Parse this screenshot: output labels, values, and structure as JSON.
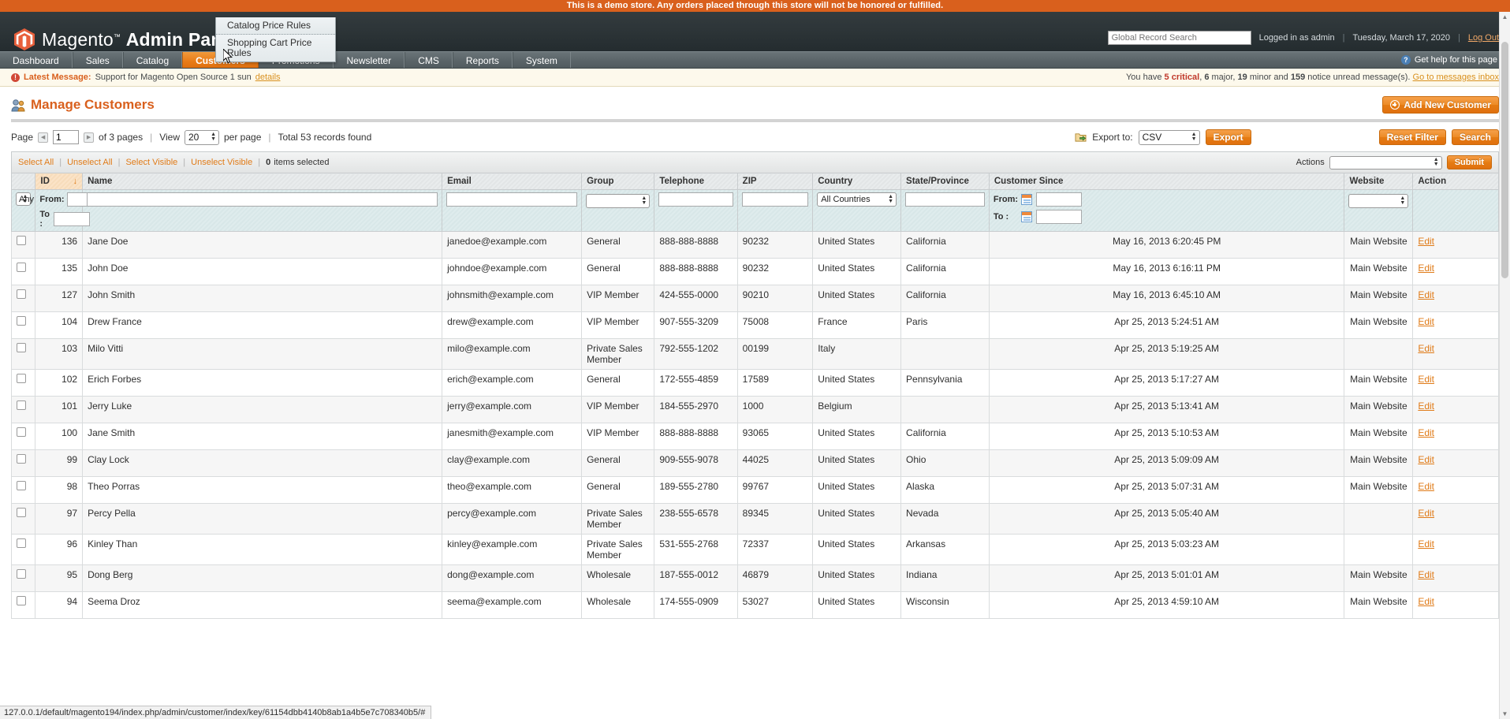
{
  "demo_banner": "This is a demo store. Any orders placed through this store will not be honored or fulfilled.",
  "header": {
    "logo_text_light": "Magento",
    "logo_tm": "™",
    "logo_text_bold": "Admin Panel",
    "search_placeholder": "Global Record Search",
    "search_value": "",
    "logged_in": "Logged in as admin",
    "date": "Tuesday, March 17, 2020",
    "logout": "Log Out",
    "sep": "|"
  },
  "nav": {
    "items": [
      {
        "label": "Dashboard",
        "active": false
      },
      {
        "label": "Sales",
        "active": false
      },
      {
        "label": "Catalog",
        "active": false
      },
      {
        "label": "Customers",
        "active": true
      },
      {
        "label": "Promotions",
        "active": false
      },
      {
        "label": "Newsletter",
        "active": false
      },
      {
        "label": "CMS",
        "active": false
      },
      {
        "label": "Reports",
        "active": false
      },
      {
        "label": "System",
        "active": false
      }
    ],
    "help_icon": "question-mark-icon",
    "help_label": "Get help for this page",
    "dropdown": {
      "parent": "Promotions",
      "items": [
        "Catalog Price Rules",
        "Shopping Cart Price Rules"
      ]
    }
  },
  "message_bar": {
    "icon": "alert-icon",
    "label": "Latest Message:",
    "body": "Support for Magento Open Source 1 sun",
    "details_link": "details",
    "right_prefix": "You have",
    "critical_count": "5",
    "critical_word": "critical",
    "major_count": "6",
    "major_word": "major,",
    "minor_count": "19",
    "minor_word": "minor and",
    "notice_count": "159",
    "notice_word": "notice unread message(s).",
    "inbox_link": "Go to messages inbox"
  },
  "page": {
    "title": "Manage Customers",
    "title_icon": "customers-icon",
    "add_button": "Add New Customer"
  },
  "toolbar": {
    "page_label": "Page",
    "page_value": "1",
    "of_pages": "of 3 pages",
    "view_label": "View",
    "per_page_value": "20",
    "per_page_label": "per page",
    "total_records": "Total 53 records found",
    "export_icon": "export-icon",
    "export_label": "Export to:",
    "export_format": "CSV",
    "export_button": "Export",
    "reset_filter_button": "Reset Filter",
    "search_button": "Search",
    "separator": "|"
  },
  "massaction": {
    "select_all": "Select All",
    "unselect_all": "Unselect All",
    "select_visible": "Select Visible",
    "unselect_visible": "Unselect Visible",
    "items_selected_count": "0",
    "items_selected_label": "items selected",
    "actions_label": "Actions",
    "actions_value": "",
    "submit_button": "Submit",
    "separator": "|"
  },
  "grid": {
    "columns": [
      {
        "key": "checkbox",
        "label": ""
      },
      {
        "key": "id",
        "label": "ID",
        "sorted": true,
        "sort_dir": "desc"
      },
      {
        "key": "name",
        "label": "Name"
      },
      {
        "key": "email",
        "label": "Email"
      },
      {
        "key": "group",
        "label": "Group"
      },
      {
        "key": "telephone",
        "label": "Telephone"
      },
      {
        "key": "zip",
        "label": "ZIP"
      },
      {
        "key": "country",
        "label": "Country"
      },
      {
        "key": "state",
        "label": "State/Province"
      },
      {
        "key": "since",
        "label": "Customer Since"
      },
      {
        "key": "website",
        "label": "Website"
      },
      {
        "key": "action",
        "label": "Action"
      }
    ],
    "filters": {
      "any_select": "Any",
      "id_from_label": "From:",
      "id_to_label": "To :",
      "id_from": "",
      "id_to": "",
      "name": "",
      "email": "",
      "group": "",
      "telephone": "",
      "zip": "",
      "country": "All Countries",
      "state": "",
      "since_from_label": "From:",
      "since_to_label": "To :",
      "since_from": "",
      "since_to": "",
      "website": ""
    },
    "edit_label": "Edit",
    "rows": [
      {
        "id": "136",
        "name": "Jane Doe",
        "email": "janedoe@example.com",
        "group": "General",
        "telephone": "888-888-8888",
        "zip": "90232",
        "country": "United States",
        "state": "California",
        "since": "May 16, 2013 6:20:45 PM",
        "website": "Main Website"
      },
      {
        "id": "135",
        "name": "John Doe",
        "email": "johndoe@example.com",
        "group": "General",
        "telephone": "888-888-8888",
        "zip": "90232",
        "country": "United States",
        "state": "California",
        "since": "May 16, 2013 6:16:11 PM",
        "website": "Main Website"
      },
      {
        "id": "127",
        "name": "John Smith",
        "email": "johnsmith@example.com",
        "group": "VIP Member",
        "telephone": "424-555-0000",
        "zip": "90210",
        "country": "United States",
        "state": "California",
        "since": "May 16, 2013 6:45:10 AM",
        "website": "Main Website"
      },
      {
        "id": "104",
        "name": "Drew France",
        "email": "drew@example.com",
        "group": "VIP Member",
        "telephone": "907-555-3209",
        "zip": "75008",
        "country": "France",
        "state": "Paris",
        "since": "Apr 25, 2013 5:24:51 AM",
        "website": "Main Website"
      },
      {
        "id": "103",
        "name": "Milo Vitti",
        "email": "milo@example.com",
        "group": "Private Sales Member",
        "telephone": "792-555-1202",
        "zip": "00199",
        "country": "Italy",
        "state": "",
        "since": "Apr 25, 2013 5:19:25 AM",
        "website": ""
      },
      {
        "id": "102",
        "name": "Erich Forbes",
        "email": "erich@example.com",
        "group": "General",
        "telephone": "172-555-4859",
        "zip": "17589",
        "country": "United States",
        "state": "Pennsylvania",
        "since": "Apr 25, 2013 5:17:27 AM",
        "website": "Main Website"
      },
      {
        "id": "101",
        "name": "Jerry Luke",
        "email": "jerry@example.com",
        "group": "VIP Member",
        "telephone": "184-555-2970",
        "zip": "1000",
        "country": "Belgium",
        "state": "",
        "since": "Apr 25, 2013 5:13:41 AM",
        "website": "Main Website"
      },
      {
        "id": "100",
        "name": "Jane Smith",
        "email": "janesmith@example.com",
        "group": "VIP Member",
        "telephone": "888-888-8888",
        "zip": "93065",
        "country": "United States",
        "state": "California",
        "since": "Apr 25, 2013 5:10:53 AM",
        "website": "Main Website"
      },
      {
        "id": "99",
        "name": "Clay Lock",
        "email": "clay@example.com",
        "group": "General",
        "telephone": "909-555-9078",
        "zip": "44025",
        "country": "United States",
        "state": "Ohio",
        "since": "Apr 25, 2013 5:09:09 AM",
        "website": "Main Website"
      },
      {
        "id": "98",
        "name": "Theo Porras",
        "email": "theo@example.com",
        "group": "General",
        "telephone": "189-555-2780",
        "zip": "99767",
        "country": "United States",
        "state": "Alaska",
        "since": "Apr 25, 2013 5:07:31 AM",
        "website": "Main Website"
      },
      {
        "id": "97",
        "name": "Percy Pella",
        "email": "percy@example.com",
        "group": "Private Sales Member",
        "telephone": "238-555-6578",
        "zip": "89345",
        "country": "United States",
        "state": "Nevada",
        "since": "Apr 25, 2013 5:05:40 AM",
        "website": ""
      },
      {
        "id": "96",
        "name": "Kinley Than",
        "email": "kinley@example.com",
        "group": "Private Sales Member",
        "telephone": "531-555-2768",
        "zip": "72337",
        "country": "United States",
        "state": "Arkansas",
        "since": "Apr 25, 2013 5:03:23 AM",
        "website": ""
      },
      {
        "id": "95",
        "name": "Dong Berg",
        "email": "dong@example.com",
        "group": "Wholesale",
        "telephone": "187-555-0012",
        "zip": "46879",
        "country": "United States",
        "state": "Indiana",
        "since": "Apr 25, 2013 5:01:01 AM",
        "website": "Main Website"
      },
      {
        "id": "94",
        "name": "Seema Droz",
        "email": "seema@example.com",
        "group": "Wholesale",
        "telephone": "174-555-0909",
        "zip": "53027",
        "country": "United States",
        "state": "Wisconsin",
        "since": "Apr 25, 2013 4:59:10 AM",
        "website": "Main Website"
      }
    ]
  },
  "status_bar": {
    "url": "127.0.0.1/default/magento194/index.php/admin/customer/index/key/61154dbb4140b8ab1a4b5e7c708340b5/#"
  },
  "colors": {
    "accent_orange": "#e07b18",
    "banner_orange": "#d9601d",
    "header_dark": "#2d3538",
    "nav_gray": "#5c666a",
    "message_bg": "#fdf9ec",
    "filter_row": "#dfeced"
  }
}
